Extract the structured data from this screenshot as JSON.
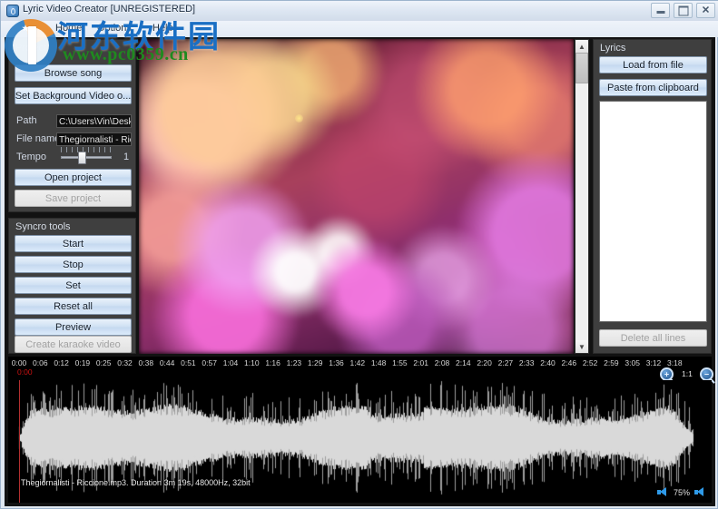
{
  "window": {
    "title": "Lyric Video Creator [UNREGISTERED]",
    "app_icon": "app-icon",
    "minimize": "–",
    "maximize": "□",
    "close": "✕"
  },
  "menu": {
    "items": [
      {
        "label": "Home"
      },
      {
        "label": "Options"
      },
      {
        "label": "Help"
      }
    ]
  },
  "project_panel": {
    "title": "Project",
    "browse_song": "Browse song",
    "set_background": "Set Background Video o...",
    "path_label": "Path",
    "path_value": "C:\\Users\\Vin\\Deskt",
    "filename_label": "File name",
    "filename_value": "Thegiornalisti - Ricc",
    "tempo_label": "Tempo",
    "tempo_value": "1",
    "open_project": "Open project",
    "save_project": "Save project"
  },
  "syncro_panel": {
    "title": "Syncro tools",
    "buttons": [
      {
        "label": "Start",
        "disabled": false
      },
      {
        "label": "Stop",
        "disabled": false
      },
      {
        "label": "Set",
        "disabled": false
      },
      {
        "label": "Reset all",
        "disabled": false
      },
      {
        "label": "Preview",
        "disabled": false
      },
      {
        "label": "Create karaoke video",
        "disabled": true
      }
    ]
  },
  "lyrics_panel": {
    "title": "Lyrics",
    "load_from_file": "Load from file",
    "paste_from_clipboard": "Paste from clipboard",
    "text_value": "",
    "delete_all_lines": "Delete all lines",
    "scroll_up_icon": "chevron-up-icon",
    "scroll_down_icon": "chevron-down-icon"
  },
  "video_preview": {
    "scroll_up_icon": "chevron-up-icon",
    "scroll_down_icon": "chevron-down-icon"
  },
  "timeline": {
    "ticks": [
      "0:00",
      "0:06",
      "0:12",
      "0:19",
      "0:25",
      "0:32",
      "0:38",
      "0:44",
      "0:51",
      "0:57",
      "1:04",
      "1:10",
      "1:16",
      "1:23",
      "1:29",
      "1:36",
      "1:42",
      "1:48",
      "1:55",
      "2:01",
      "2:08",
      "2:14",
      "2:20",
      "2:27",
      "2:33",
      "2:40",
      "2:46",
      "2:52",
      "2:59",
      "3:05",
      "3:12",
      "3:18"
    ],
    "cursor_time": "0:00",
    "zoom_in": "+",
    "zoom_out": "−",
    "zoom_reset": "1:1",
    "accent_red": "#cc1111"
  },
  "waveform": {
    "status": "Thegiornalisti - Riccione.mp3. Duration 3m 19s, 48000Hz, 32bit",
    "volume": "75%",
    "volume_down_icon": "speaker-down-icon",
    "volume_up_icon": "speaker-up-icon"
  },
  "watermark": {
    "site_name": "河东软件园",
    "url": "www.pc0359.cn"
  }
}
